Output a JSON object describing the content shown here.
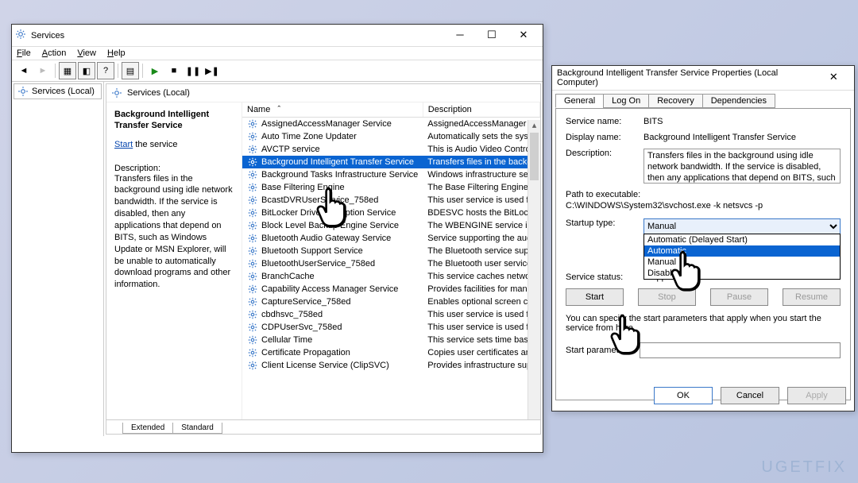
{
  "services_window": {
    "title": "Services",
    "menus": [
      "File",
      "Action",
      "View",
      "Help"
    ],
    "left_pane_label": "Services (Local)",
    "header_label": "Services (Local)",
    "selected_service_title": "Background Intelligent Transfer Service",
    "start_link": "Start",
    "start_suffix": " the service",
    "desc_label": "Description:",
    "desc_text": "Transfers files in the background using idle network bandwidth. If the service is disabled, then any applications that depend on BITS, such as Windows Update or MSN Explorer, will be unable to automatically download programs and other information.",
    "columns": [
      "Name",
      "Description"
    ],
    "rows": [
      {
        "name": "AssignedAccessManager Service",
        "desc": "AssignedAccessManager Se"
      },
      {
        "name": "Auto Time Zone Updater",
        "desc": "Automatically sets the syste"
      },
      {
        "name": "AVCTP service",
        "desc": "This is Audio Video Control"
      },
      {
        "name": "Background Intelligent Transfer Service",
        "desc": "Transfers files in the backgro",
        "selected": true
      },
      {
        "name": "Background Tasks Infrastructure Service",
        "desc": "Windows infrastructure serv"
      },
      {
        "name": "Base Filtering Engine",
        "desc": "The Base Filtering Engine (B"
      },
      {
        "name": "BcastDVRUserService_758ed",
        "desc": "This user service is used for"
      },
      {
        "name": "BitLocker Drive Encryption Service",
        "desc": "BDESVC hosts the BitLocker"
      },
      {
        "name": "Block Level Backup Engine Service",
        "desc": "The WBENGINE service is us"
      },
      {
        "name": "Bluetooth Audio Gateway Service",
        "desc": "Service supporting the audi"
      },
      {
        "name": "Bluetooth Support Service",
        "desc": "The Bluetooth service suppo"
      },
      {
        "name": "BluetoothUserService_758ed",
        "desc": "The Bluetooth user service s"
      },
      {
        "name": "BranchCache",
        "desc": "This service caches network"
      },
      {
        "name": "Capability Access Manager Service",
        "desc": "Provides facilities for manag"
      },
      {
        "name": "CaptureService_758ed",
        "desc": "Enables optional screen cap"
      },
      {
        "name": "cbdhsvc_758ed",
        "desc": "This user service is used for"
      },
      {
        "name": "CDPUserSvc_758ed",
        "desc": "This user service is used for"
      },
      {
        "name": "Cellular Time",
        "desc": "This service sets time based"
      },
      {
        "name": "Certificate Propagation",
        "desc": "Copies user certificates and"
      },
      {
        "name": "Client License Service (ClipSVC)",
        "desc": "Provides infrastructure supp"
      }
    ],
    "tabs_bottom": [
      "Extended",
      "Standard"
    ]
  },
  "properties_dialog": {
    "title": "Background Intelligent Transfer Service Properties (Local Computer)",
    "tabs": [
      "General",
      "Log On",
      "Recovery",
      "Dependencies"
    ],
    "labels": {
      "service_name": "Service name:",
      "display_name": "Display name:",
      "description": "Description:",
      "path": "Path to executable:",
      "startup_type": "Startup type:",
      "service_status": "Service status:",
      "start_params_hint": "You can specify the start parameters that apply when you start the service from here.",
      "start_params": "Start parameters:"
    },
    "values": {
      "service_name": "BITS",
      "display_name": "Background Intelligent Transfer Service",
      "description": "Transfers files in the background using idle network bandwidth. If the service is disabled, then any applications that depend on BITS, such as Windows",
      "path": "C:\\WINDOWS\\System32\\svchost.exe -k netsvcs -p",
      "startup_selected": "Manual",
      "service_status": "Stopped"
    },
    "startup_options": [
      "Automatic (Delayed Start)",
      "Automatic",
      "Manual",
      "Disabled"
    ],
    "startup_highlight": "Automatic",
    "buttons": {
      "start": "Start",
      "stop": "Stop",
      "pause": "Pause",
      "resume": "Resume",
      "ok": "OK",
      "cancel": "Cancel",
      "apply": "Apply"
    }
  },
  "watermark": "UGETFIX"
}
